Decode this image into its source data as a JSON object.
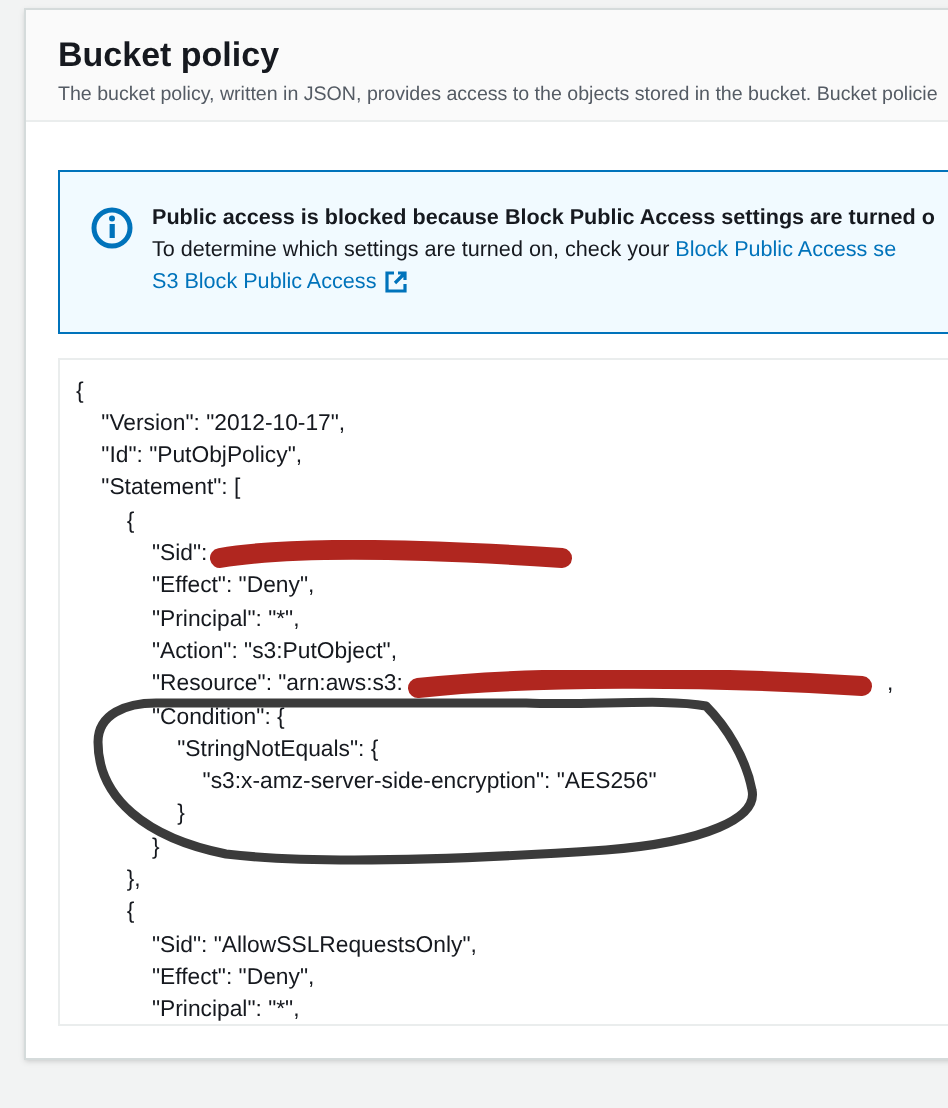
{
  "header": {
    "title": "Bucket policy",
    "description": "The bucket policy, written in JSON, provides access to the objects stored in the bucket. Bucket policie"
  },
  "alert": {
    "title": "Public access is blocked because Block Public Access settings are turned o",
    "text": "To determine which settings are turned on, check your ",
    "link": "Block Public Access se",
    "learn_more_link": "S3 Block Public Access"
  },
  "editor": {
    "lines": [
      {
        "kind": "plain",
        "text": "{"
      },
      {
        "kind": "plain",
        "text": "    \"Version\": \"2012-10-17\","
      },
      {
        "kind": "plain",
        "text": "    \"Id\": \"PutObjPolicy\","
      },
      {
        "kind": "plain",
        "text": "    \"Statement\": ["
      },
      {
        "kind": "plain",
        "text": "        {"
      },
      {
        "kind": "redacted",
        "text": "            \"Sid\":"
      },
      {
        "kind": "plain",
        "text": "            \"Effect\": \"Deny\","
      },
      {
        "kind": "plain",
        "text": "            \"Principal\": \"*\","
      },
      {
        "kind": "plain",
        "text": "            \"Action\": \"s3:PutObject\","
      },
      {
        "kind": "redacted",
        "text": "            \"Resource\": \"arn:aws:s3:",
        "after": ","
      },
      {
        "kind": "plain",
        "text": "            \"Condition\": {"
      },
      {
        "kind": "plain",
        "text": "                \"StringNotEquals\": {"
      },
      {
        "kind": "plain",
        "text": "                    \"s3:x-amz-server-side-encryption\": \"AES256\""
      },
      {
        "kind": "plain",
        "text": "                }"
      },
      {
        "kind": "plain",
        "text": "            }"
      },
      {
        "kind": "plain",
        "text": "        },"
      },
      {
        "kind": "plain",
        "text": "        {"
      },
      {
        "kind": "plain",
        "text": "            \"Sid\": \"AllowSSLRequestsOnly\","
      },
      {
        "kind": "plain",
        "text": "            \"Effect\": \"Deny\","
      },
      {
        "kind": "plain",
        "text": "            \"Principal\": \"*\","
      }
    ]
  }
}
